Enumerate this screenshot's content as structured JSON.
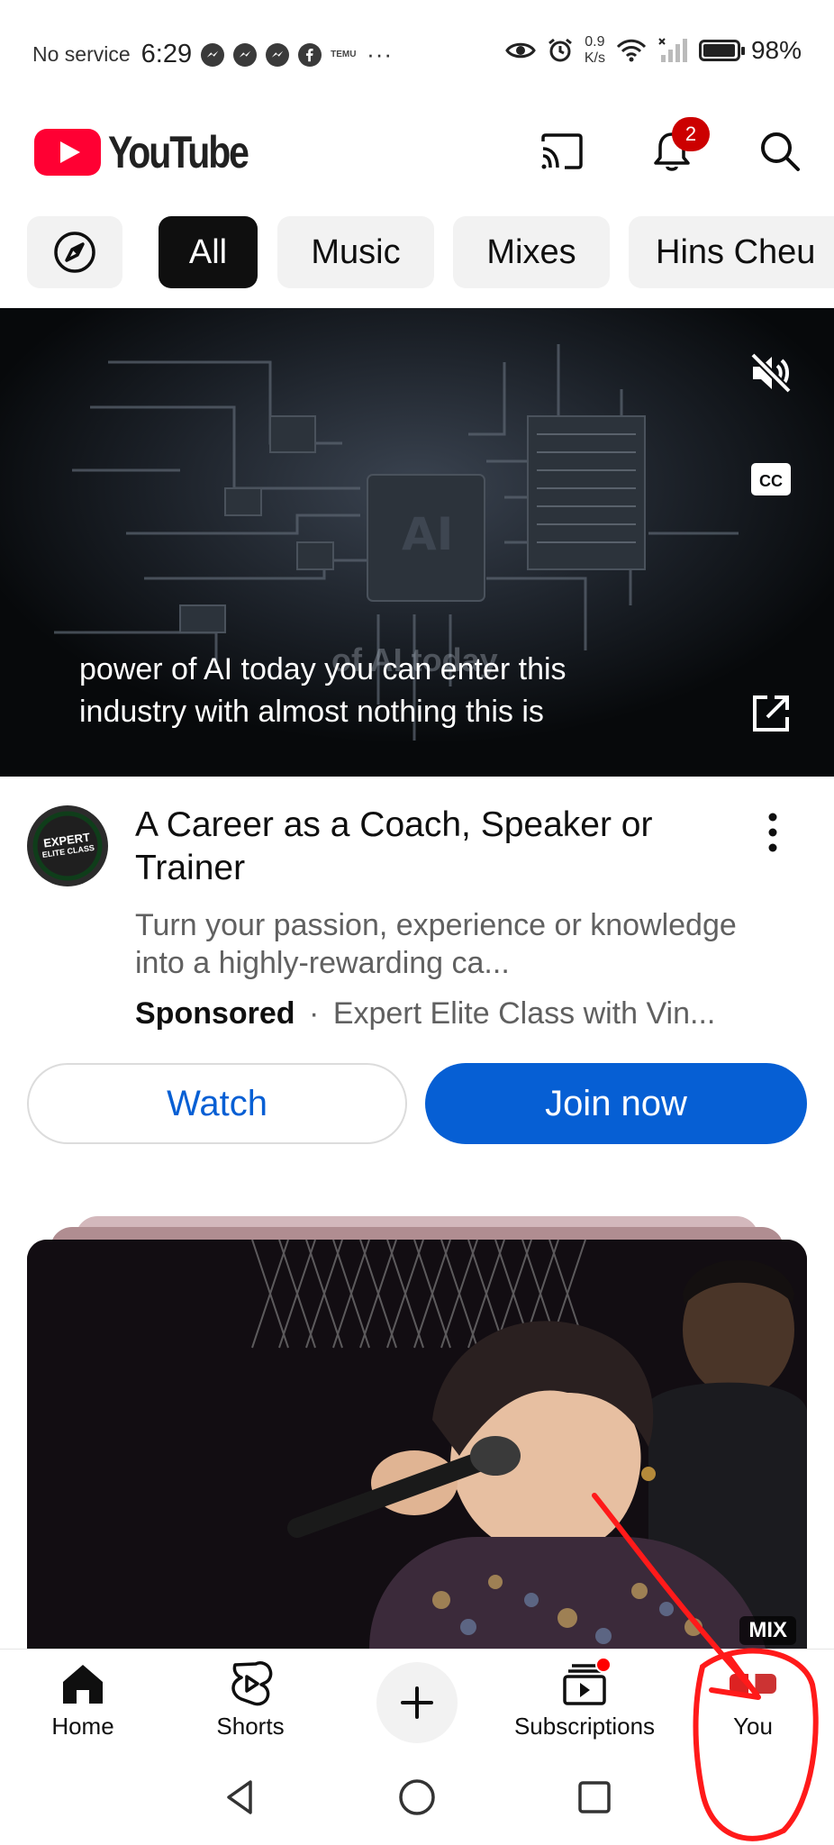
{
  "status_bar": {
    "service": "No service",
    "time": "6:29",
    "app_icons": [
      "messenger-icon",
      "messenger-icon",
      "messenger-icon",
      "facebook-icon",
      "temu-icon"
    ],
    "temu_label": "TEMU",
    "more": "···",
    "speed_value": "0.9",
    "speed_unit": "K/s",
    "battery_percent": "98%"
  },
  "header": {
    "app_name": "YouTube",
    "notification_count": "2"
  },
  "chips": [
    {
      "label": "All",
      "active": true
    },
    {
      "label": "Music",
      "active": false
    },
    {
      "label": "Mixes",
      "active": false
    },
    {
      "label": "Hins Cheu",
      "active": false
    }
  ],
  "ad_video": {
    "overlay_text": "of AI today",
    "caption_line1": "power of AI today you can enter this",
    "caption_line2": "industry with almost nothing this is",
    "chip_label": "AI"
  },
  "ad": {
    "avatar_text_line1": "EXPERT",
    "avatar_text_line2": "ELITE CLASS",
    "title": "A Career as a Coach, Speaker or Trainer",
    "description": "Turn your passion, experience or knowledge into a highly-rewarding ca...",
    "sponsored": "Sponsored",
    "separator": "·",
    "advertiser": "Expert Elite Class with Vin...",
    "watch_label": "Watch",
    "join_label": "Join now"
  },
  "mix_card": {
    "badge": "MIX"
  },
  "bottom_nav": {
    "home": "Home",
    "shorts": "Shorts",
    "subscriptions": "Subscriptions",
    "you": "You"
  },
  "colors": {
    "brand_red": "#ff0033",
    "link_blue": "#065fd4",
    "annotation_red": "#ff1a1a"
  }
}
